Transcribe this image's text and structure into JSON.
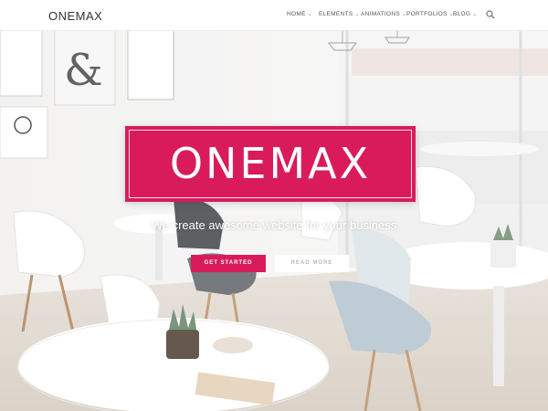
{
  "header": {
    "logo": "ONEMAX",
    "nav": [
      {
        "label": "HOME"
      },
      {
        "label": "ELEMENTS"
      },
      {
        "label": "ANIMATIONS"
      },
      {
        "label": "PORTFOLIOS"
      },
      {
        "label": "BLOG"
      }
    ],
    "search_icon": "search-icon"
  },
  "hero": {
    "title": "ONEMAX",
    "subtitle": "We create awesome website for your business",
    "primary_button": "GET STARTED",
    "secondary_button": "READ MORE",
    "accent_color": "#d91b5c"
  }
}
